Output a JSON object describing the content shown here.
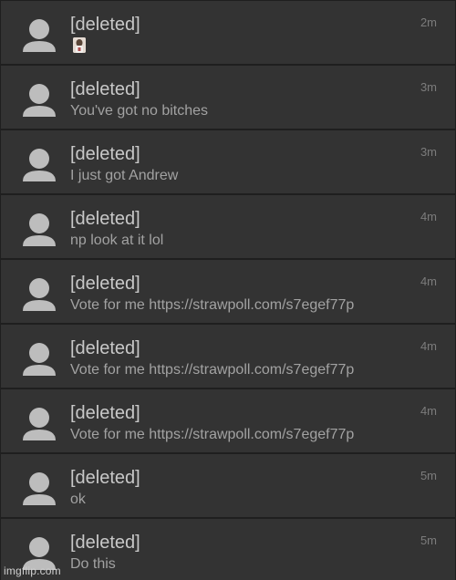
{
  "messages": [
    {
      "username": "[deleted]",
      "text": "",
      "time": "2m",
      "has_image": true
    },
    {
      "username": "[deleted]",
      "text": "You've got no bitches",
      "time": "3m"
    },
    {
      "username": "[deleted]",
      "text": "I just got Andrew",
      "time": "3m"
    },
    {
      "username": "[deleted]",
      "text": "np look at it lol",
      "time": "4m"
    },
    {
      "username": "[deleted]",
      "text": "Vote for me https://strawpoll.com/s7egef77p",
      "time": "4m"
    },
    {
      "username": "[deleted]",
      "text": "Vote for me https://strawpoll.com/s7egef77p",
      "time": "4m"
    },
    {
      "username": "[deleted]",
      "text": "Vote for me https://strawpoll.com/s7egef77p",
      "time": "4m"
    },
    {
      "username": "[deleted]",
      "text": "ok",
      "time": "5m"
    },
    {
      "username": "[deleted]",
      "text": "Do this",
      "time": "5m"
    }
  ],
  "watermark": "imgflip.com",
  "icons": {
    "avatar": "default-user-icon",
    "image": "image-thumbnail-icon"
  },
  "colors": {
    "background": "#1f1f1f",
    "row": "#333333",
    "username": "#c8c8c8",
    "text": "#a2a2a2",
    "time": "#7c7c7c"
  }
}
